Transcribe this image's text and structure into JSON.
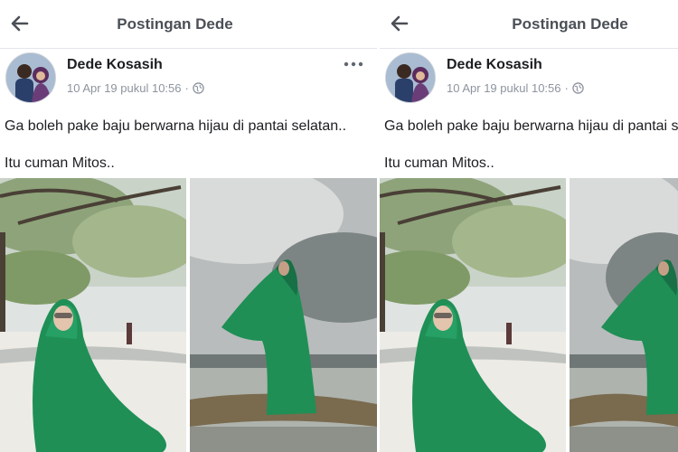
{
  "header": {
    "title": "Postingan Dede"
  },
  "post": {
    "author": "Dede Kosasih",
    "date": "10 Apr 19 pukul 10:56",
    "separator": "·",
    "text_line1": "Ga boleh pake baju berwarna hijau di pantai selatan..",
    "text_line2": "Itu cuman Mitos.."
  },
  "icons": {
    "back": "arrow-left-icon",
    "privacy": "globe-icon",
    "more": "more-dots-icon"
  },
  "colors": {
    "title_text": "#4b4f56",
    "meta_text": "#8d949e",
    "garment_green": "#1f8f55"
  }
}
